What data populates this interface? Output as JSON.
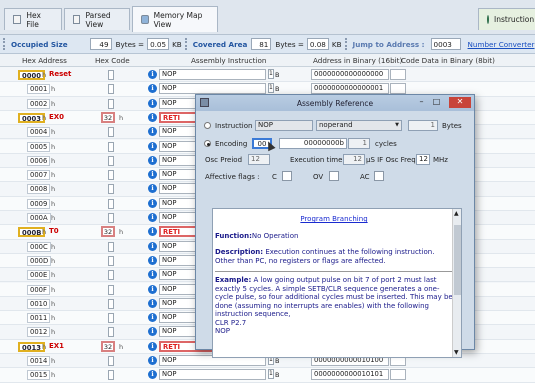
{
  "tabs": [
    {
      "label": "Hex File"
    },
    {
      "label": "Parsed View"
    },
    {
      "label": "Memory Map View"
    },
    {
      "label": "Instruction se"
    }
  ],
  "toolbar": {
    "occupied_label": "Occupied Size",
    "occupied_value": "49",
    "bytes_label1": "Bytes =",
    "kb_value1": "0.05",
    "kb_label1": "KB",
    "covered_label": "Covered Area",
    "covered_value": "81",
    "bytes_label2": "Bytes =",
    "kb_value2": "0.08",
    "kb_label2": "KB",
    "jump_label": "Jump to Address :",
    "jump_value": "0003",
    "number_converter": "Number Converter"
  },
  "columns": [
    "Hex Address",
    "Hex Code",
    "Assembly Instruction",
    "Address in Binary (16bit)",
    "Code Data in Binary (8bit)"
  ],
  "rows": [
    {
      "addr": "0000",
      "suffix": "h",
      "label": "Reset",
      "code": "",
      "instr": "NOP",
      "bit": "1",
      "bsuf": "B",
      "bin": "0000000000000000"
    },
    {
      "addr": "0001",
      "suffix": "h",
      "label": "",
      "code": "",
      "instr": "NOP",
      "bit": "1",
      "bsuf": "B",
      "bin": "0000000000000001"
    },
    {
      "addr": "0002",
      "suffix": "h",
      "label": "",
      "code": "",
      "instr": "NOP",
      "bit": "1",
      "bsuf": "B",
      "bin": "000000000000"
    },
    {
      "addr": "0003",
      "suffix": "h",
      "label": "EX0",
      "code": "32",
      "instr": "RETI",
      "bit": "",
      "bsuf": "",
      "bin": ""
    },
    {
      "addr": "0004",
      "suffix": "h",
      "label": "",
      "code": "",
      "instr": "NOP",
      "bit": "",
      "bsuf": "",
      "bin": ""
    },
    {
      "addr": "0005",
      "suffix": "h",
      "label": "",
      "code": "",
      "instr": "NOP",
      "bit": "",
      "bsuf": "",
      "bin": ""
    },
    {
      "addr": "0006",
      "suffix": "h",
      "label": "",
      "code": "",
      "instr": "NOP",
      "bit": "",
      "bsuf": "",
      "bin": ""
    },
    {
      "addr": "0007",
      "suffix": "h",
      "label": "",
      "code": "",
      "instr": "NOP",
      "bit": "",
      "bsuf": "",
      "bin": ""
    },
    {
      "addr": "0008",
      "suffix": "h",
      "label": "",
      "code": "",
      "instr": "NOP",
      "bit": "",
      "bsuf": "",
      "bin": ""
    },
    {
      "addr": "0009",
      "suffix": "h",
      "label": "",
      "code": "",
      "instr": "NOP",
      "bit": "",
      "bsuf": "",
      "bin": ""
    },
    {
      "addr": "000A",
      "suffix": "h",
      "label": "",
      "code": "",
      "instr": "NOP",
      "bit": "",
      "bsuf": "",
      "bin": ""
    },
    {
      "addr": "000B",
      "suffix": "h",
      "label": "T0",
      "code": "32",
      "instr": "RETI",
      "bit": "",
      "bsuf": "",
      "bin": ""
    },
    {
      "addr": "000C",
      "suffix": "h",
      "label": "",
      "code": "",
      "instr": "NOP",
      "bit": "",
      "bsuf": "",
      "bin": ""
    },
    {
      "addr": "000D",
      "suffix": "h",
      "label": "",
      "code": "",
      "instr": "NOP",
      "bit": "",
      "bsuf": "",
      "bin": ""
    },
    {
      "addr": "000E",
      "suffix": "h",
      "label": "",
      "code": "",
      "instr": "NOP",
      "bit": "",
      "bsuf": "",
      "bin": ""
    },
    {
      "addr": "000F",
      "suffix": "h",
      "label": "",
      "code": "",
      "instr": "NOP",
      "bit": "",
      "bsuf": "",
      "bin": ""
    },
    {
      "addr": "0010",
      "suffix": "h",
      "label": "",
      "code": "",
      "instr": "NOP",
      "bit": "",
      "bsuf": "",
      "bin": ""
    },
    {
      "addr": "0011",
      "suffix": "h",
      "label": "",
      "code": "",
      "instr": "NOP",
      "bit": "",
      "bsuf": "",
      "bin": ""
    },
    {
      "addr": "0012",
      "suffix": "h",
      "label": "",
      "code": "",
      "instr": "NOP",
      "bit": "",
      "bsuf": "",
      "bin": ""
    },
    {
      "addr": "0013",
      "suffix": "h",
      "label": "EX1",
      "code": "32",
      "instr": "RETI",
      "bit": "",
      "bsuf": "",
      "bin": "0000000000010011"
    },
    {
      "addr": "0014",
      "suffix": "h",
      "label": "",
      "code": "",
      "instr": "NOP",
      "bit": "1",
      "bsuf": "B",
      "bin": "0000000000010100"
    },
    {
      "addr": "0015",
      "suffix": "h",
      "label": "",
      "code": "",
      "instr": "NOP",
      "bit": "1",
      "bsuf": "B",
      "bin": "0000000000010101"
    }
  ],
  "modal": {
    "title": "Assembly Reference",
    "instruction_label": "Instruction",
    "instruction_value": "NOP",
    "operand_value": "noperand",
    "bytes_value": "1",
    "bytes_label": "Bytes",
    "encoding_label": "Encoding",
    "encoding_hex": "00",
    "encoding_bin": "00000000",
    "encoding_bin_suffix": "b",
    "cycles_value": "1",
    "cycles_label": "cycles",
    "osc_label": "Osc Preiod",
    "osc_value": "12",
    "exec_label": "Execution time",
    "exec_value": "12",
    "exec_unit": "µS IF Osc Freq =",
    "freq_value": "12",
    "freq_unit": "MHz",
    "flags_label": "Affective flags :",
    "flag_c": "C",
    "flag_ov": "OV",
    "flag_ac": "AC",
    "section_title": "Program Branching",
    "function_label": "Function:",
    "function_text": "No Operation",
    "description_label": "Description:",
    "description_text": "Execution continues at the following instruction. Other than PC, no registers or flags are affected.",
    "example_label": "Example:",
    "example_text": "A low going output pulse on bit 7 of port 2 must last exactly 5 cycles. A simple SETB/CLR sequence generates a one-cycle pulse, so four additional cycles must be inserted. This may be done (assuming no interrupts are enables) with the following instruction sequence,",
    "example_code1": "CLR P2.7",
    "example_code2": "NOP"
  }
}
